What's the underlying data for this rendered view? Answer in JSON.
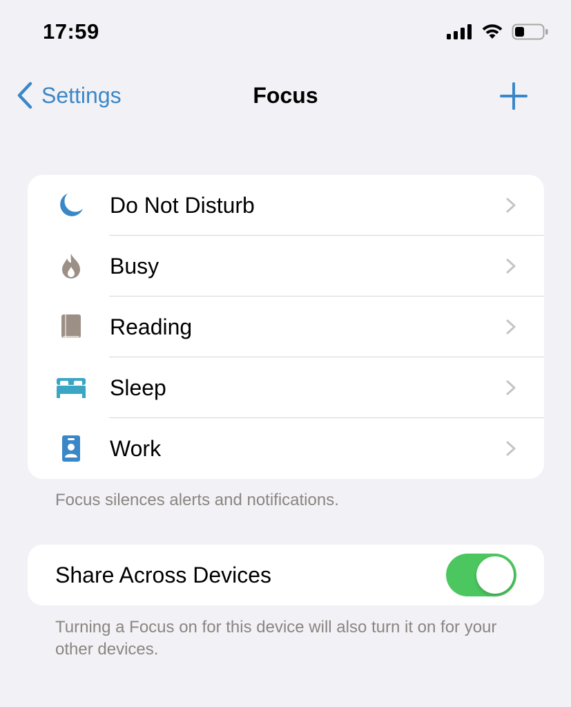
{
  "status_bar": {
    "time": "17:59",
    "icons": [
      "cellular-signal-icon",
      "wifi-icon",
      "battery-icon"
    ]
  },
  "nav": {
    "back_label": "Settings",
    "title": "Focus",
    "add_icon": "plus-icon"
  },
  "focus_modes": [
    {
      "label": "Do Not Disturb",
      "icon": "moon-icon",
      "icon_color": "#3a87c8"
    },
    {
      "label": "Busy",
      "icon": "flame-icon",
      "icon_color": "#9c8f86"
    },
    {
      "label": "Reading",
      "icon": "book-icon",
      "icon_color": "#9c8f86"
    },
    {
      "label": "Sleep",
      "icon": "bed-icon",
      "icon_color": "#3aa6c4"
    },
    {
      "label": "Work",
      "icon": "id-badge-icon",
      "icon_color": "#3a87c8"
    }
  ],
  "focus_footer": "Focus silences alerts and notifications.",
  "share": {
    "label": "Share Across Devices",
    "enabled": true,
    "footer": "Turning a Focus on for this device will also turn it on for your other devices."
  },
  "colors": {
    "accent": "#3a87c8",
    "background": "#f2f1f6",
    "toggle_on": "#4cc760",
    "chevron": "#c4c3c8",
    "footer_text": "#8a8580"
  }
}
